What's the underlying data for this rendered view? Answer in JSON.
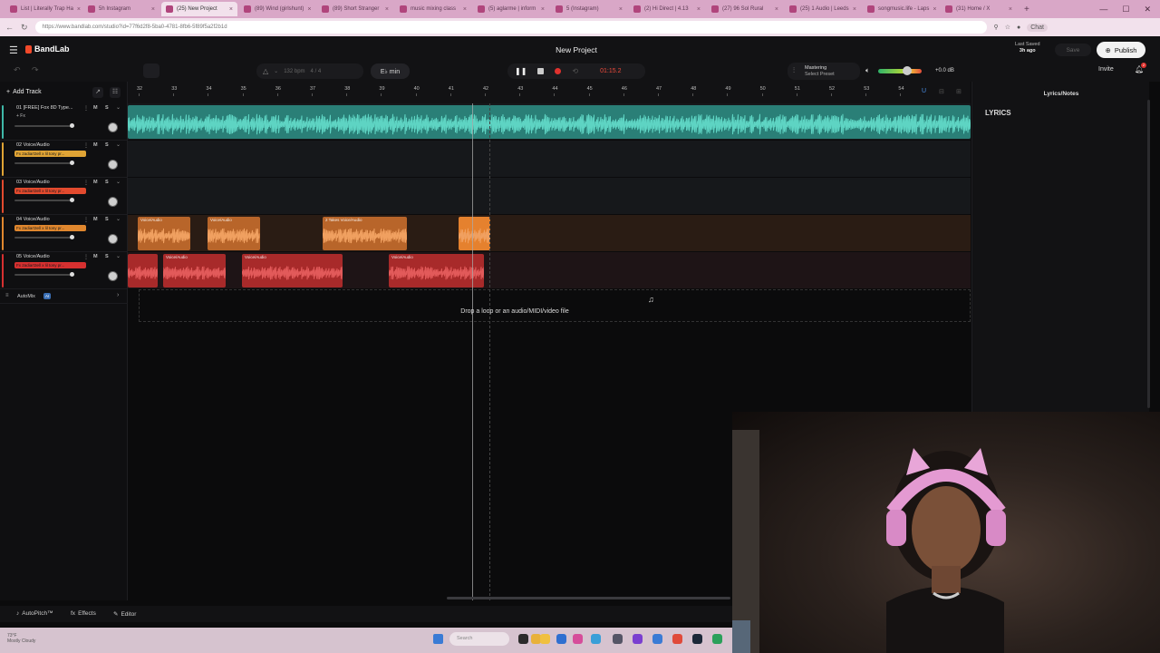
{
  "browser": {
    "tabs": [
      {
        "label": "List | Literally Trap Ha",
        "active": false
      },
      {
        "label": "5h Instagram",
        "active": false
      },
      {
        "label": "(25) New Project",
        "active": true
      },
      {
        "label": "(89) Wind (girlshunt)",
        "active": false
      },
      {
        "label": "(89) Short Stranger",
        "active": false
      },
      {
        "label": "music mixing class",
        "active": false
      },
      {
        "label": "(5) aglarme | inform",
        "active": false
      },
      {
        "label": "5 (Instagram)",
        "active": false
      },
      {
        "label": "(2) Hi Direct | 4.13",
        "active": false
      },
      {
        "label": "(27) 96 Sol Rural",
        "active": false
      },
      {
        "label": "(25) 1 Audio | Leeds",
        "active": false
      },
      {
        "label": "songmusic.life - Laps",
        "active": false
      },
      {
        "label": "(31) Home / X",
        "active": false
      }
    ],
    "url": "https://www.bandlab.com/studio?id=77f6d2f8-5ba0-4781-8fb6-5f89f5a2f2b1d",
    "chat_label": "Chat"
  },
  "header": {
    "logo": "BandLab",
    "project_title": "New Project",
    "last_saved_label": "Last Saved",
    "last_saved_value": "3h ago",
    "save_label": "Save",
    "publish_label": "Publish"
  },
  "toolbar": {
    "bpm": "132 bpm",
    "time_signature": "4 / 4",
    "key": "E♭ min",
    "time": "01:15.2",
    "mastering_label": "Mastering",
    "mastering_sub": "Select Preset",
    "volume_db": "+0.0 dB",
    "volume_level_pct": 67,
    "invite_label": "Invite",
    "notification_count": "2"
  },
  "sidebar": {
    "add_track_label": "Add Track",
    "automix_label": "AutoMix",
    "automix_badge": "AI"
  },
  "tracks": [
    {
      "name": "01 [FREE] Fox 8D Type...",
      "color": "#3fb8a8",
      "sub": "+ Fx",
      "fx": "",
      "fader_pct": 97
    },
    {
      "name": "02 Voice/Audio",
      "color": "#e0a435",
      "sub": "",
      "fx": "Fx 2adiart3ell x lil tony pr...",
      "fader_pct": 97
    },
    {
      "name": "03 Voice/Audio",
      "color": "#e24a2e",
      "sub": "",
      "fx": "Fx 2adiart3ell x lil tony pr...",
      "fader_pct": 97
    },
    {
      "name": "04 Voice/Audio",
      "color": "#e0872e",
      "sub": "",
      "fx": "Fx 2adiart3ell x lil tony pr...",
      "fader_pct": 97
    },
    {
      "name": "05 Voice/Audio",
      "color": "#d63030",
      "sub": "",
      "fx": "Fx 2adiart3ell x lil tony pr...",
      "fader_pct": 97
    }
  ],
  "ruler": {
    "bars": [
      "32",
      "33",
      "34",
      "35",
      "36",
      "37",
      "38",
      "39",
      "40",
      "41",
      "42",
      "43",
      "44",
      "45",
      "46",
      "47",
      "48",
      "49",
      "50",
      "51",
      "52",
      "53",
      "54"
    ]
  },
  "regions": {
    "track4": [
      {
        "label": "Voice/Audio"
      },
      {
        "label": "Voice/Audio"
      },
      {
        "label": "2 Takes  Voice/Audio"
      },
      {
        "label": ""
      }
    ],
    "track5": [
      {
        "label": ""
      },
      {
        "label": "Voice/Audio"
      },
      {
        "label": "Voice/Audio"
      },
      {
        "label": "Voice/Audio"
      }
    ]
  },
  "drop_zone_text": "Drop a loop or an audio/MIDI/video file",
  "lyrics": {
    "panel_title": "Lyrics/Notes",
    "heading": "LYRICS"
  },
  "bottombar": {
    "autopitch": "AutoPitch™",
    "effects": "Effects",
    "editor": "Editor"
  },
  "taskbar": {
    "weather_temp": "73°F",
    "weather_desc": "Mostly Cloudy",
    "search_placeholder": "Search"
  }
}
